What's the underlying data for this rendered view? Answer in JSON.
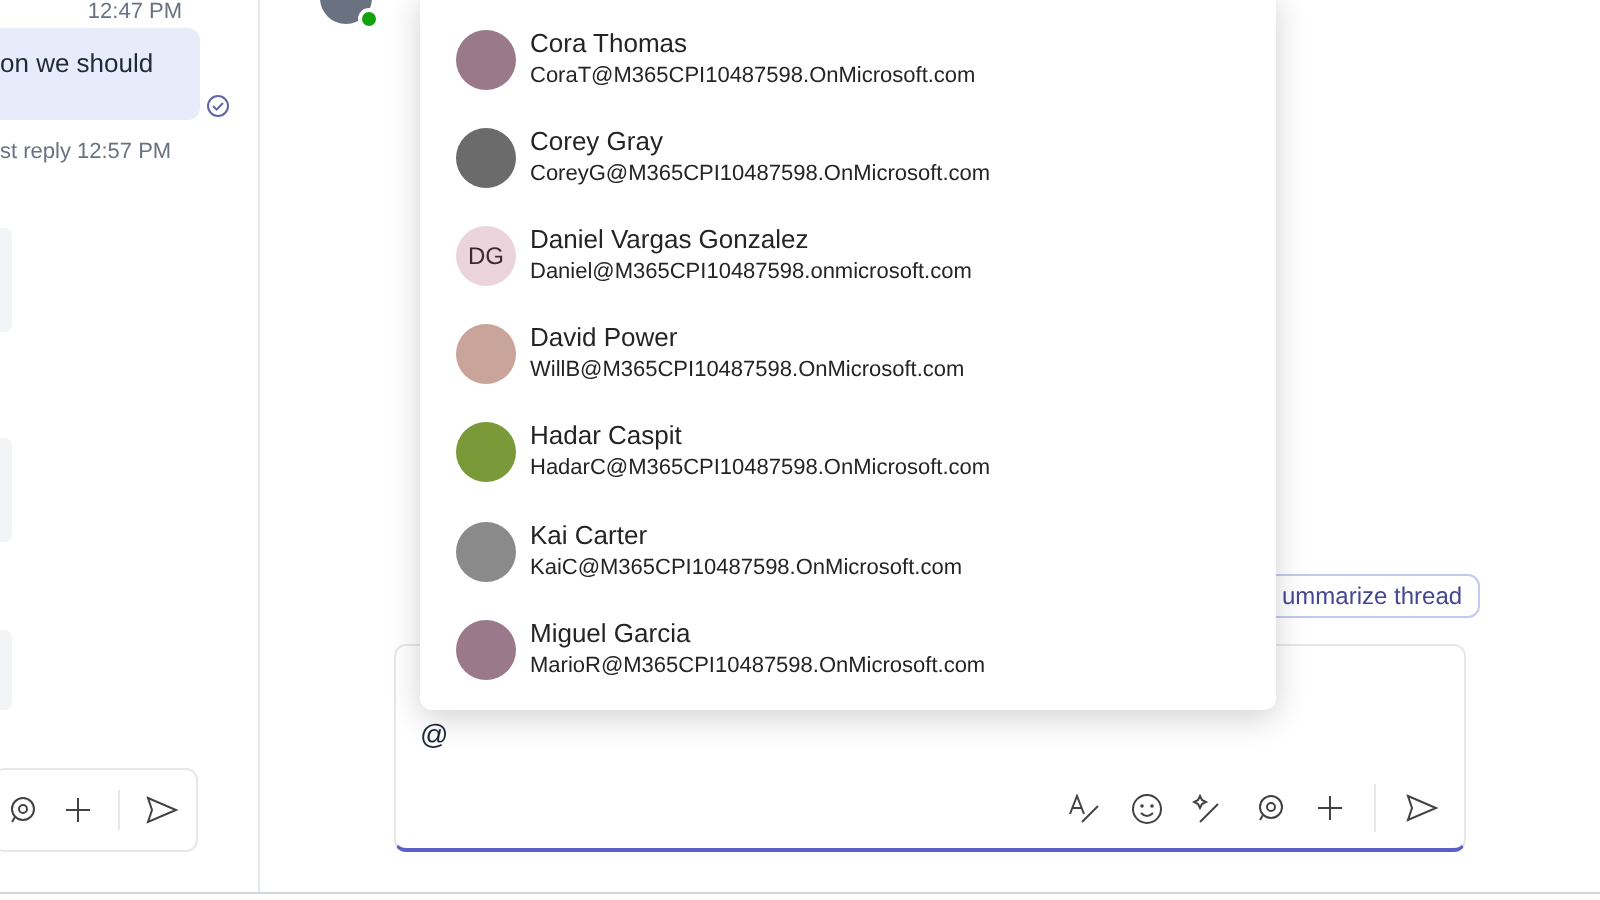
{
  "left_pane": {
    "time": "12:47 PM",
    "message": "on we should",
    "last_reply": "st reply 12:57 PM"
  },
  "mention_list": [
    {
      "name": "Cora Thomas",
      "email": "CoraT@M365CPI10487598.OnMicrosoft.com",
      "kind": "photo"
    },
    {
      "name": "Corey Gray",
      "email": "CoreyG@M365CPI10487598.OnMicrosoft.com",
      "kind": "photo"
    },
    {
      "name": "Daniel Vargas Gonzalez",
      "email": "Daniel@M365CPI10487598.onmicrosoft.com",
      "kind": "initials",
      "initials": "DG"
    },
    {
      "name": "David Power",
      "email": "WillB@M365CPI10487598.OnMicrosoft.com",
      "kind": "photo"
    },
    {
      "name": "Hadar Caspit",
      "email": "HadarC@M365CPI10487598.OnMicrosoft.com",
      "kind": "photo"
    },
    {
      "name": "Kai Carter",
      "email": "KaiC@M365CPI10487598.OnMicrosoft.com",
      "kind": "photo"
    },
    {
      "name": "Miguel Garcia",
      "email": "MarioR@M365CPI10487598.OnMicrosoft.com",
      "kind": "photo"
    }
  ],
  "summarize_button": "ummarize thread",
  "composer": {
    "value": "@"
  }
}
